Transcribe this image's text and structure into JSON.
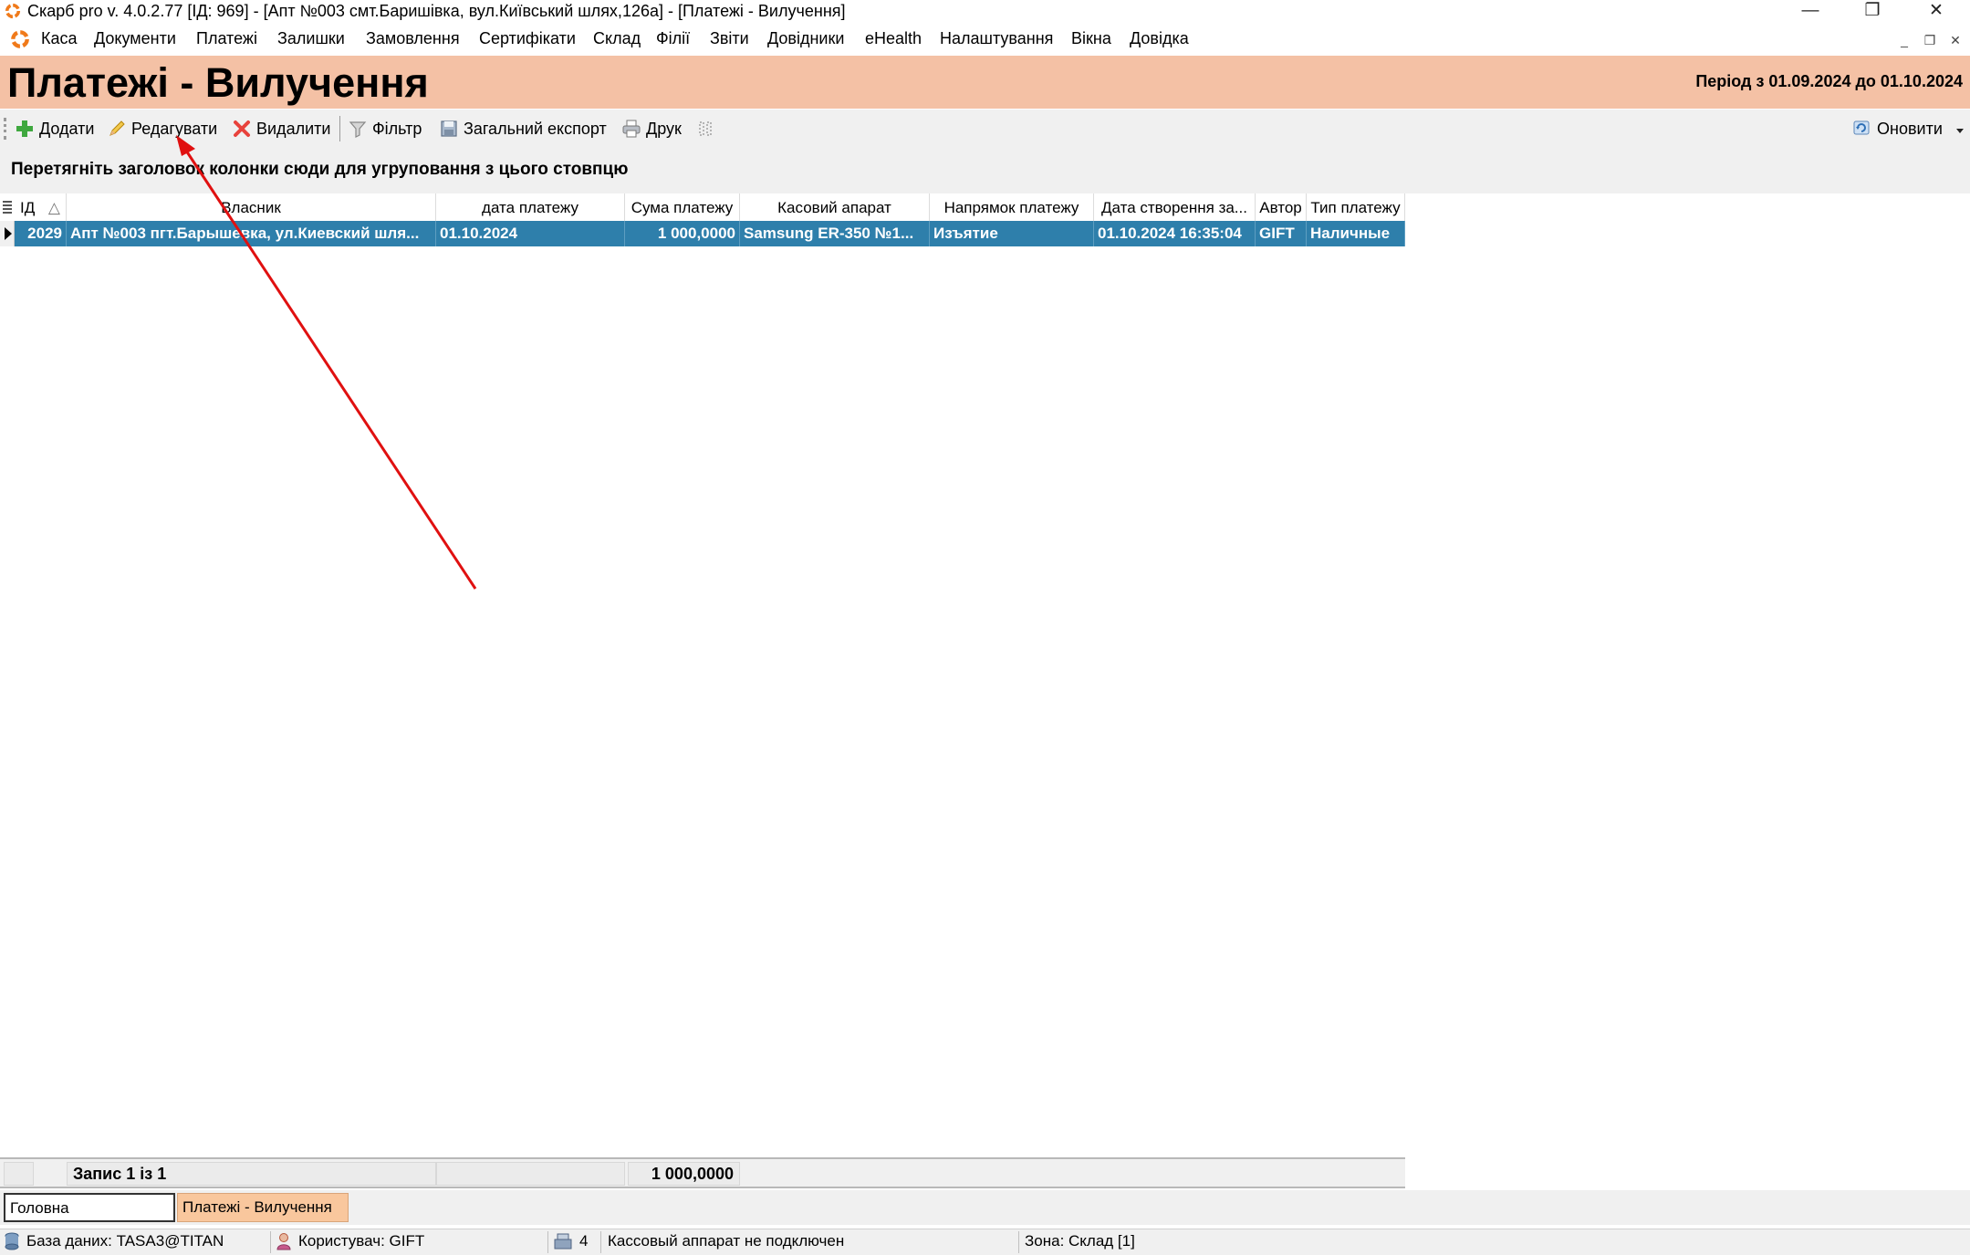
{
  "window": {
    "title": "Скарб pro v. 4.0.2.77 [ІД: 969] - [Апт №003 смт.Баришівка, вул.Київський шлях,126а] - [Платежі - Вилучення]",
    "minimize": "—",
    "restore": "❐",
    "close": "✕"
  },
  "menu": {
    "items": [
      "Каса",
      "Документи",
      "Платежі",
      "Залишки",
      "Замовлення",
      "Сертифікати",
      "Склад",
      "Філії",
      "Звіти",
      "Довідники",
      "eHealth",
      "Налаштування",
      "Вікна",
      "Довідка"
    ],
    "mdi_minimize": "_",
    "mdi_restore": "❐",
    "mdi_close": "✕"
  },
  "header": {
    "title": "Платежі - Вилучення",
    "period": "Період з 01.09.2024 до 01.10.2024"
  },
  "toolbar": {
    "add": "Додати",
    "edit": "Редагувати",
    "delete": "Видалити",
    "filter": "Фільтр",
    "export": "Загальний експорт",
    "print": "Друк",
    "refresh": "Оновити"
  },
  "group_panel": {
    "hint": "Перетягніть заголовок колонки сюди для угруповання з цього стовпцю"
  },
  "grid": {
    "columns": [
      "ІД",
      "Власник",
      "дата платежу",
      "Сума платежу",
      "Касовий апарат",
      "Напрямок платежу",
      "Дата створення за...",
      "Автор",
      "Тип платежу"
    ],
    "sort_indicator": "△",
    "rows": [
      [
        "2029",
        "Апт №003 пгт.Барышевка, ул.Киевский шля...",
        "01.10.2024",
        "1 000,0000",
        "Samsung ER-350 №1...",
        "Изъятие",
        "01.10.2024 16:35:04",
        "GIFT",
        "Наличные"
      ]
    ]
  },
  "footer": {
    "record_count": "Запис 1 із 1",
    "sum_total": "1 000,0000"
  },
  "tabs": {
    "items": [
      "Головна",
      "Платежі - Вилучення"
    ],
    "active_index": 1
  },
  "status": {
    "database": "База даних: TASA3@TITAN",
    "user": "Користувач: GIFT",
    "count": "4",
    "cash_register": "Кассовый аппарат не подключен",
    "zone": "Зона: Склад [1]"
  },
  "colors": {
    "header_bg": "#f4c1a5",
    "selected_row": "#2e7fab",
    "active_tab": "#f9c79d",
    "annotation_arrow": "#e01010"
  }
}
